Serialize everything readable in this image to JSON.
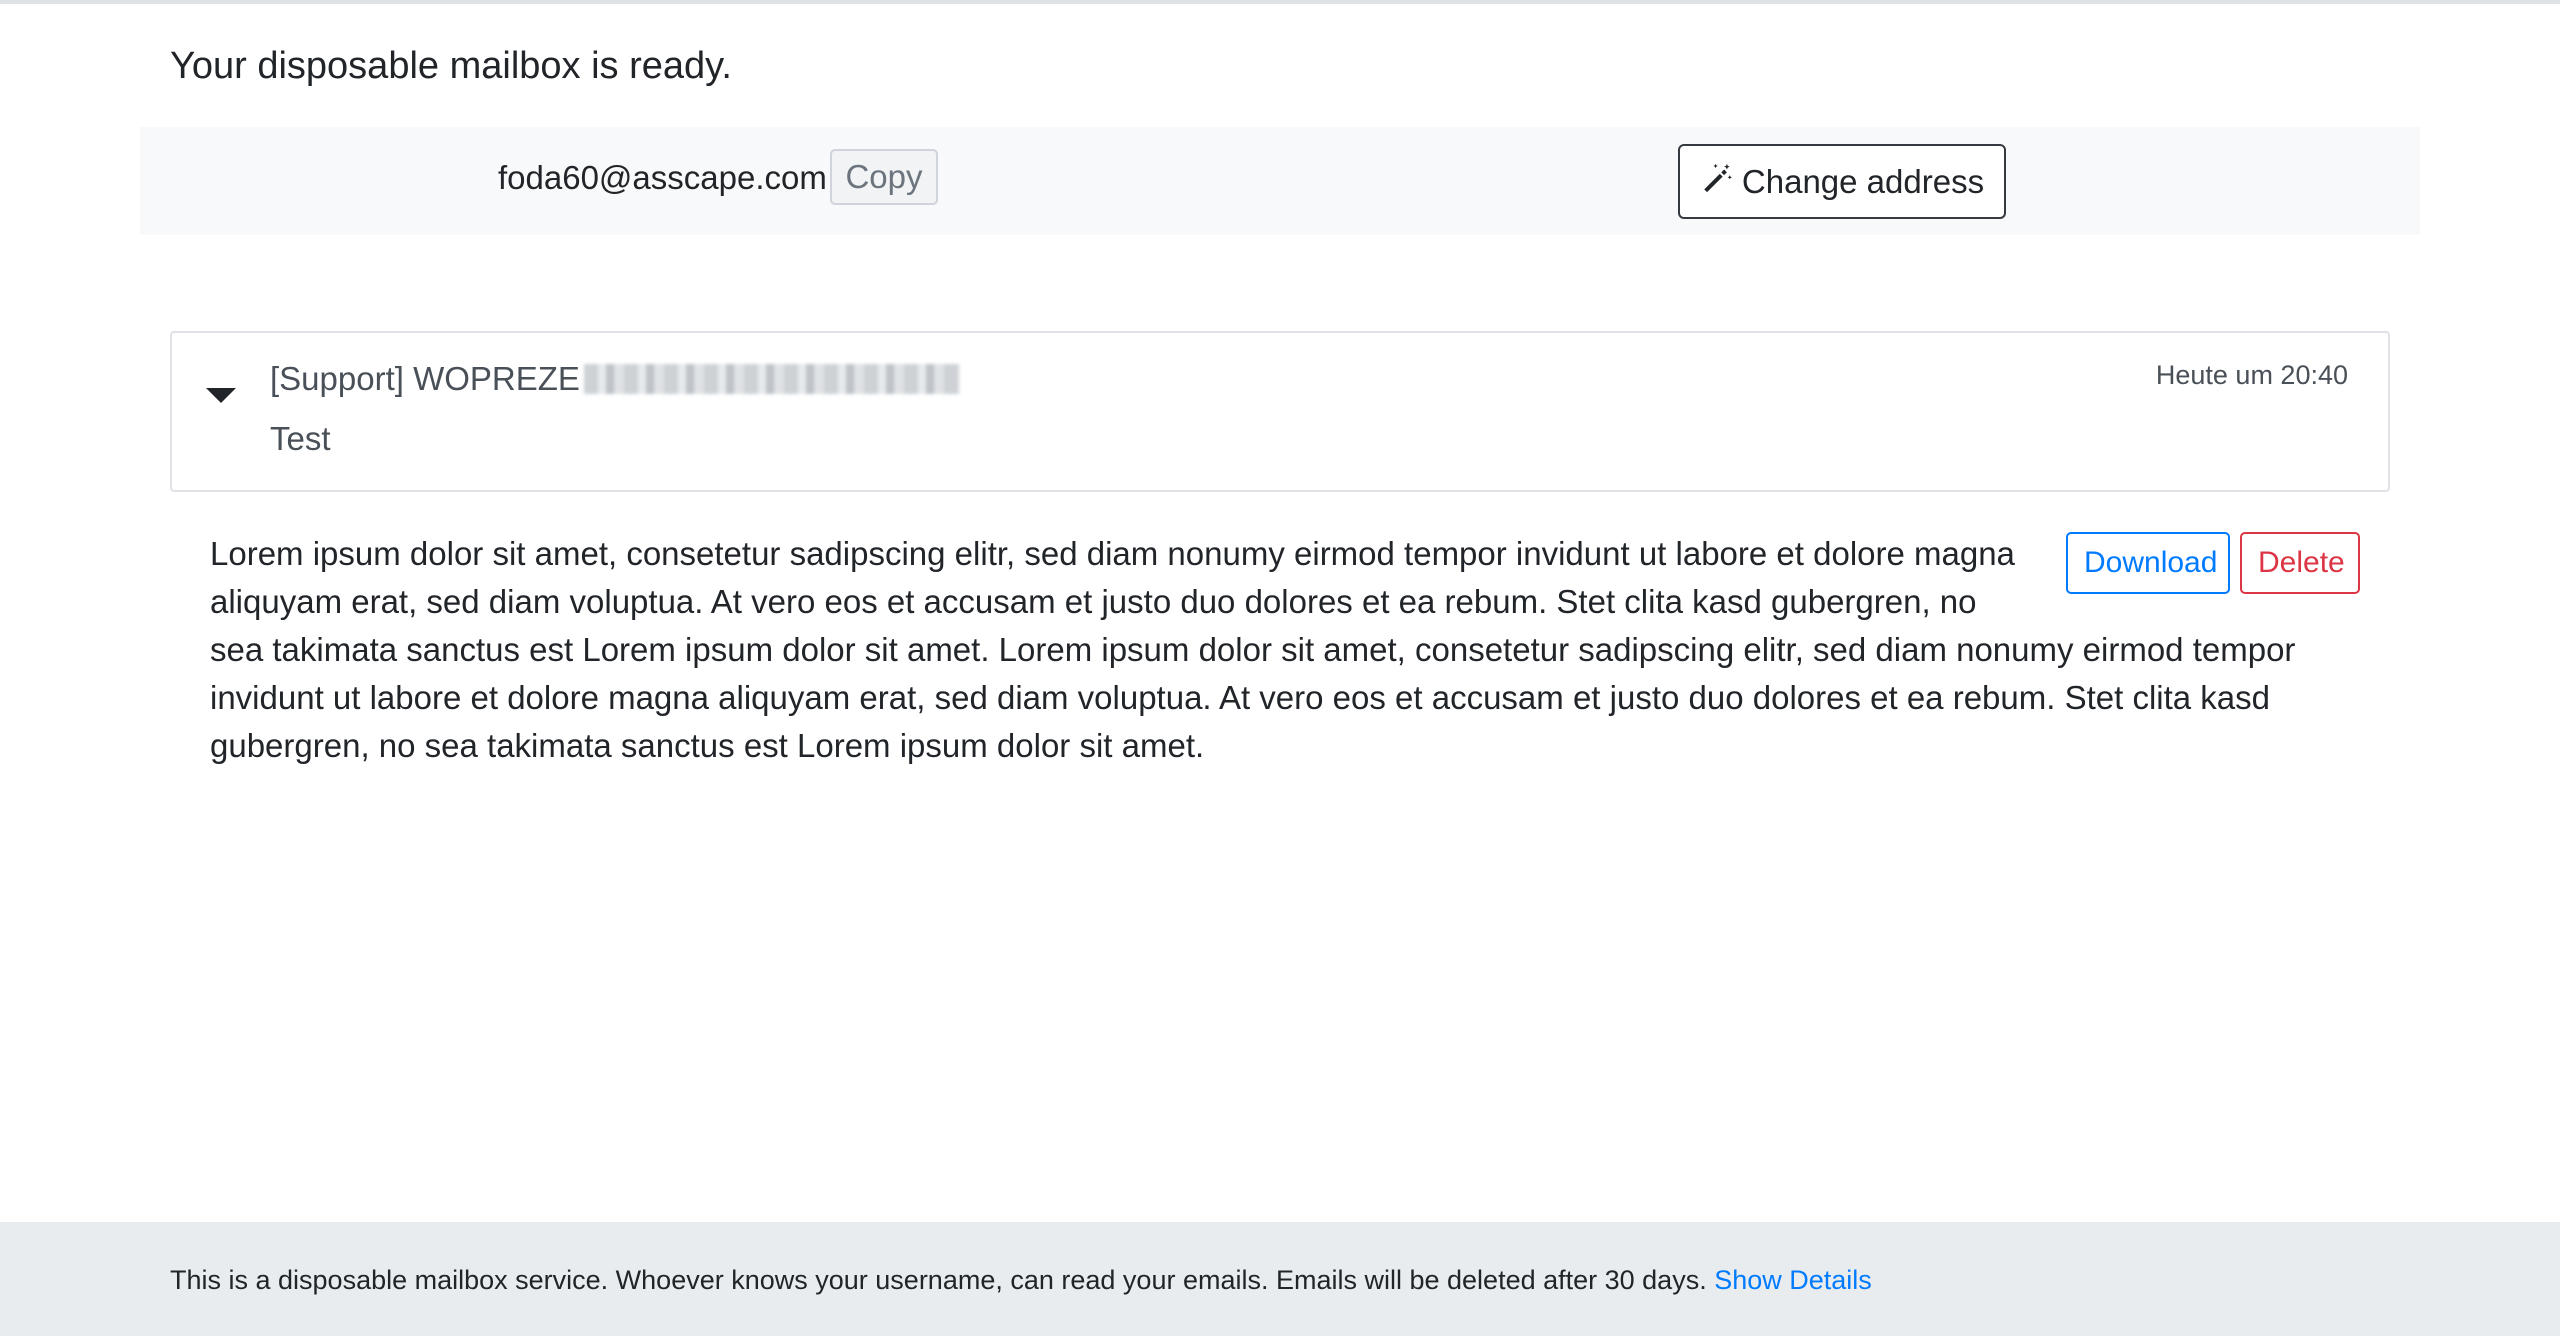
{
  "page": {
    "headline": "Your disposable mailbox is ready."
  },
  "mailbox": {
    "address": "foda60@asscape.com",
    "copy_label": "Copy",
    "change_label": "Change address"
  },
  "message": {
    "sender": "[Support] WOPREZE",
    "subject": "Test",
    "time": "Heute um 20:40",
    "body": "Lorem ipsum dolor sit amet, consetetur sadipscing elitr, sed diam nonumy eirmod tempor invidunt ut labore et dolore magna aliquyam erat, sed diam voluptua. At vero eos et accusam et justo duo dolores et ea rebum. Stet clita kasd gubergren, no sea takimata sanctus est Lorem ipsum dolor sit amet. Lorem ipsum dolor sit amet, consetetur sadipscing elitr, sed diam nonumy eirmod tempor invidunt ut labore et dolore magna aliquyam erat, sed diam voluptua. At vero eos et accusam et justo duo dolores et ea rebum. Stet clita kasd gubergren, no sea takimata sanctus est Lorem ipsum dolor sit amet.",
    "download_label": "Download",
    "delete_label": "Delete"
  },
  "footer": {
    "notice": "This is a disposable mailbox service. Whoever knows your username, can read your emails. Emails will be deleted after 30 days. ",
    "details_link": "Show Details"
  },
  "colors": {
    "link": "#007bff",
    "danger": "#dc3545",
    "footer_bg": "#e9ecef",
    "address_bar_bg": "#f8f9fa"
  },
  "icons": [
    "magic-wand-icon",
    "caret-down-icon"
  ]
}
